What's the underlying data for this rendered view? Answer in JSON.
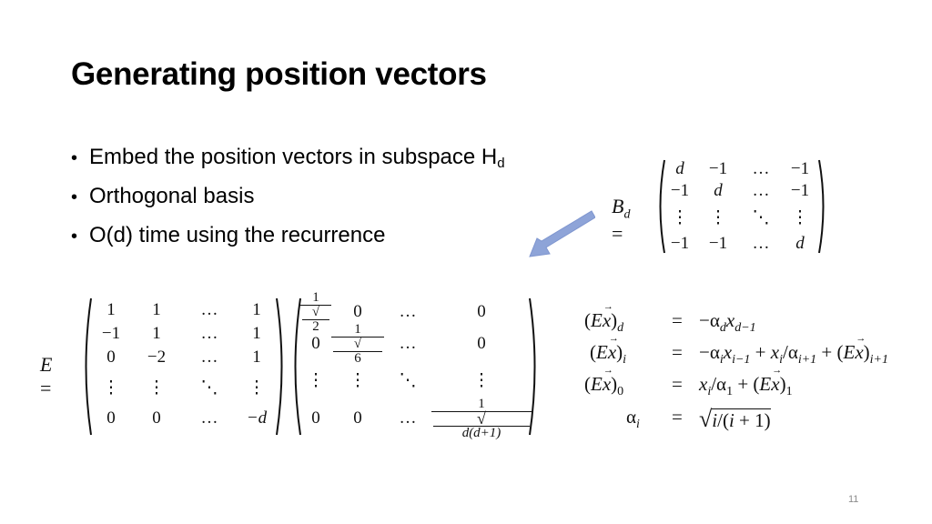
{
  "slide": {
    "title": "Generating position vectors",
    "bullets": [
      {
        "text": "Embed the position vectors in subspace H",
        "subscript": "d"
      },
      {
        "text": "Orthogonal basis",
        "subscript": ""
      },
      {
        "text": "O(d) time using the recurrence",
        "subscript": ""
      }
    ],
    "bullet_glyph": "•",
    "page_number": "11",
    "arrow": {
      "icon": "arrow-down-left-icon",
      "color": "#8ea4d8"
    }
  },
  "matrix_B": {
    "lhs": "B",
    "lhs_sub": "d",
    "equals": "=",
    "rows": [
      [
        "d",
        "−1",
        "…",
        "−1"
      ],
      [
        "−1",
        "d",
        "…",
        "−1"
      ],
      [
        "⋮",
        "⋮",
        "⋱",
        "⋮"
      ],
      [
        "−1",
        "−1",
        "…",
        "d"
      ]
    ]
  },
  "matrix_E": {
    "lhs": "E",
    "equals": "=",
    "left_rows": [
      [
        "1",
        "1",
        "…",
        "1"
      ],
      [
        "−1",
        "1",
        "…",
        "1"
      ],
      [
        "0",
        "−2",
        "…",
        "1"
      ],
      [
        "⋮",
        "⋮",
        "⋱",
        "⋮"
      ],
      [
        "0",
        "0",
        "…",
        "−d"
      ]
    ],
    "right_rows": [
      [
        "1/√2",
        "0",
        "…",
        "0"
      ],
      [
        "0",
        "1/√6",
        "…",
        "0"
      ],
      [
        "⋮",
        "⋮",
        "⋱",
        "⋮"
      ],
      [
        "0",
        "0",
        "…",
        "1/√(d(d+1))"
      ]
    ],
    "right_fracs": {
      "r0c0_num": "1",
      "r0c0_den": "2",
      "r1c1_num": "1",
      "r1c1_den": "6",
      "r3c3_num": "1",
      "r3c3_den": "d(d+1)"
    }
  },
  "recurrence": [
    {
      "lhs": "(Ex⃗)_d",
      "rhs": "−α_d x_{d−1}"
    },
    {
      "lhs": "(Ex⃗)_i",
      "rhs": "−α_i x_{i−1} + x_i/α_{i+1} + (Ex⃗)_{i+1}"
    },
    {
      "lhs": "(Ex⃗)_0",
      "rhs": "x_i/α_1 + (Ex⃗)_1"
    },
    {
      "lhs": "α_i",
      "rhs": "√(i/(i+1))"
    }
  ]
}
